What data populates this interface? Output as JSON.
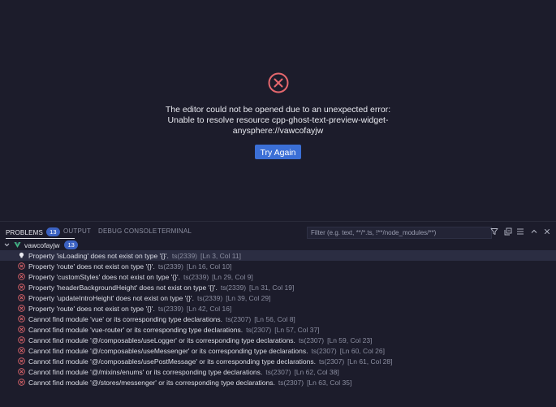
{
  "editor": {
    "error_message": "The editor could not be opened due to an unexpected error: Unable to resolve resource cpp-ghost-text-preview-widget-anysphere://vawcofayjw",
    "try_again_label": "Try Again"
  },
  "panel": {
    "tabs": [
      {
        "label": "PROBLEMS",
        "badge": "13",
        "active": true
      },
      {
        "label": "OUTPUT"
      },
      {
        "label": "DEBUG CONSOLE"
      },
      {
        "label": "TERMINAL"
      }
    ],
    "filter_placeholder": "Filter (e.g. text, **/*.ts, !**/node_modules/**)",
    "icons": [
      "filter-icon",
      "collapse-all-icon",
      "more-icon",
      "maximize-icon",
      "close-icon"
    ]
  },
  "problems": {
    "group": {
      "name": "vawcofayjw",
      "count": "13"
    },
    "items": [
      {
        "type": "info",
        "message": "Property 'isLoading' does not exist on type '{}'.",
        "code": "ts(2339)",
        "location": "[Ln 3, Col 11]"
      },
      {
        "type": "error",
        "message": "Property 'route' does not exist on type '{}'.",
        "code": "ts(2339)",
        "location": "[Ln 16, Col 10]"
      },
      {
        "type": "error",
        "message": "Property 'customStyles' does not exist on type '{}'.",
        "code": "ts(2339)",
        "location": "[Ln 29, Col 9]"
      },
      {
        "type": "error",
        "message": "Property 'headerBackgroundHeight' does not exist on type '{}'.",
        "code": "ts(2339)",
        "location": "[Ln 31, Col 19]"
      },
      {
        "type": "error",
        "message": "Property 'updateIntroHeight' does not exist on type '{}'.",
        "code": "ts(2339)",
        "location": "[Ln 39, Col 29]"
      },
      {
        "type": "error",
        "message": "Property 'route' does not exist on type '{}'.",
        "code": "ts(2339)",
        "location": "[Ln 42, Col 16]"
      },
      {
        "type": "error",
        "message": "Cannot find module 'vue' or its corresponding type declarations.",
        "code": "ts(2307)",
        "location": "[Ln 56, Col 8]"
      },
      {
        "type": "error",
        "message": "Cannot find module 'vue-router' or its corresponding type declarations.",
        "code": "ts(2307)",
        "location": "[Ln 57, Col 37]"
      },
      {
        "type": "error",
        "message": "Cannot find module '@/composables/useLogger' or its corresponding type declarations.",
        "code": "ts(2307)",
        "location": "[Ln 59, Col 23]"
      },
      {
        "type": "error",
        "message": "Cannot find module '@/composables/useMessenger' or its corresponding type declarations.",
        "code": "ts(2307)",
        "location": "[Ln 60, Col 26]"
      },
      {
        "type": "error",
        "message": "Cannot find module '@/composables/usePostMessage' or its corresponding type declarations.",
        "code": "ts(2307)",
        "location": "[Ln 61, Col 28]"
      },
      {
        "type": "error",
        "message": "Cannot find module '@/mixins/enums' or its corresponding type declarations.",
        "code": "ts(2307)",
        "location": "[Ln 62, Col 38]"
      },
      {
        "type": "error",
        "message": "Cannot find module '@/stores/messenger' or its corresponding type declarations.",
        "code": "ts(2307)",
        "location": "[Ln 63, Col 35]"
      }
    ]
  },
  "colors": {
    "background": "#1c1c2b",
    "error": "#e4676d",
    "accent": "#3b6fd6",
    "vue_green": "#42b883"
  }
}
